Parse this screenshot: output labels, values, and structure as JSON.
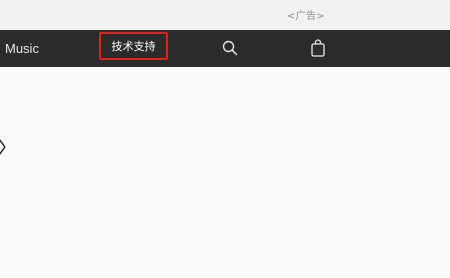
{
  "banner": {
    "ad_label": "<广告>"
  },
  "navbar": {
    "music_label": "Music",
    "support_label": "技术支持",
    "search_icon": "search-icon",
    "bag_icon": "shopping-bag-icon",
    "highlight_color": "#e0221b",
    "background_color": "#2b2b2b"
  },
  "content": {
    "close_icon": "close-icon"
  }
}
